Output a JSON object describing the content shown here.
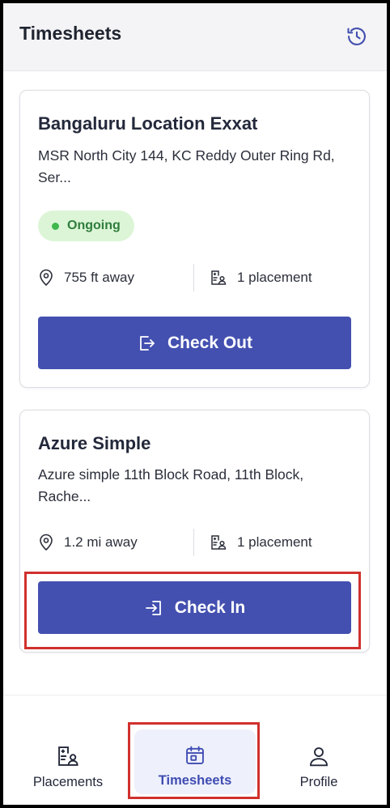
{
  "header": {
    "title": "Timesheets",
    "history_icon": "history-icon"
  },
  "cards": [
    {
      "title": "Bangaluru Location Exxat",
      "address": "MSR North City 144, KC Reddy Outer Ring Rd, Ser...",
      "status": "Ongoing",
      "distance": "755 ft away",
      "placements": "1 placement",
      "action_label": "Check Out"
    },
    {
      "title": "Azure Simple",
      "address": "Azure simple 11th Block Road, 11th Block, Rache...",
      "distance": "1.2 mi away",
      "placements": "1 placement",
      "action_label": "Check In"
    }
  ],
  "nav": {
    "items": [
      {
        "label": "Placements",
        "icon": "placements-icon"
      },
      {
        "label": "Timesheets",
        "icon": "calendar-icon",
        "active": true
      },
      {
        "label": "Profile",
        "icon": "person-icon"
      }
    ]
  },
  "colors": {
    "primary": "#4350b0",
    "status_bg": "#dcf5d7",
    "status_text": "#2e7d3b",
    "highlight": "#d0312d",
    "nav_active_bg": "#eef0fb"
  }
}
